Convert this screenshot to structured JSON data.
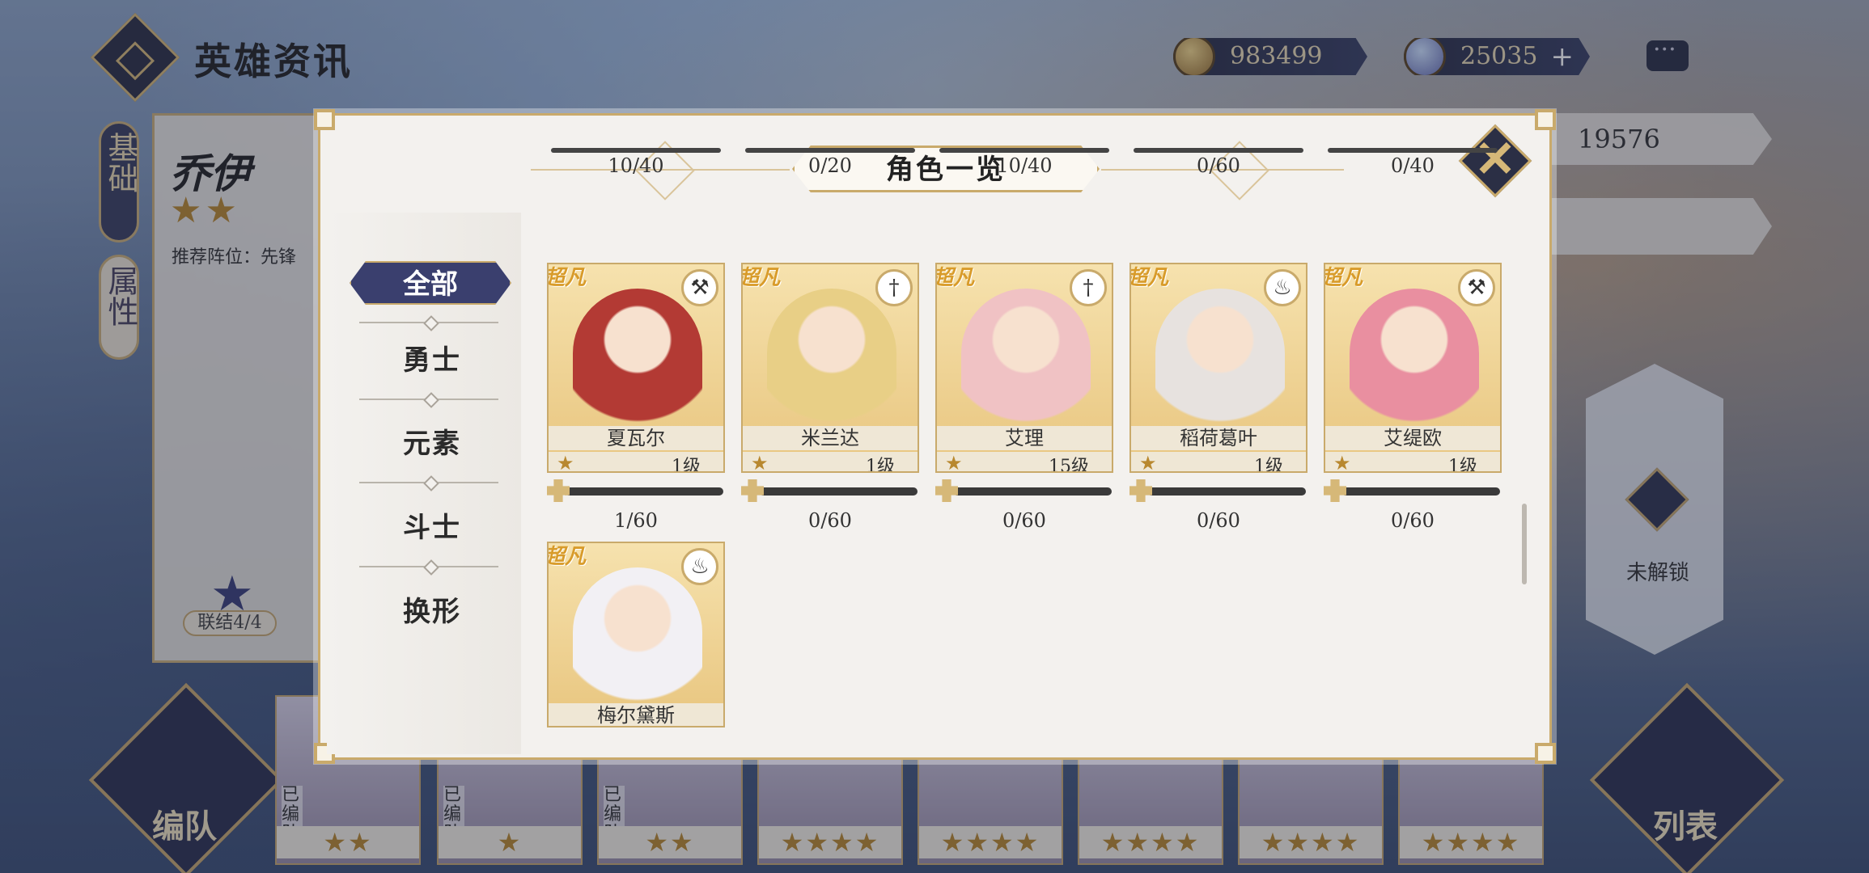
{
  "top": {
    "title": "英雄资讯",
    "gold": "983499",
    "gems": "25035",
    "gems_plus": "+"
  },
  "hero": {
    "name": "乔伊",
    "stars": "★★",
    "recommend": "推荐阵位：先锋",
    "bond": "联结4/4",
    "power": "19576"
  },
  "side_tabs": [
    "基础",
    "属性"
  ],
  "lock": {
    "label": "未解锁"
  },
  "bottom": {
    "team_label": "编队",
    "list_label": "列表",
    "in_team": "已编队"
  },
  "roster_stars": [
    "★★",
    "★",
    "★★",
    "★★★★",
    "★★★★",
    "★★★★",
    "★★★★",
    "★★★★"
  ],
  "modal": {
    "title": "角色一览",
    "close": "✕",
    "filters": [
      "全部",
      "勇士",
      "元素",
      "斗士",
      "换形"
    ],
    "top_progress": [
      "10/40",
      "0/20",
      "10/40",
      "0/60",
      "0/40"
    ],
    "heroes": [
      {
        "name": "夏瓦尔",
        "level": "1级",
        "rarity": "超凡",
        "shard": "1/60",
        "shard_fill": 0.0167,
        "element_icon": "axe-icon"
      },
      {
        "name": "米兰达",
        "level": "1级",
        "rarity": "超凡",
        "shard": "0/60",
        "shard_fill": 0,
        "element_icon": "sword-icon"
      },
      {
        "name": "艾理",
        "level": "15级",
        "rarity": "超凡",
        "shard": "0/60",
        "shard_fill": 0,
        "element_icon": "sword-icon"
      },
      {
        "name": "稻荷葛叶",
        "level": "1级",
        "rarity": "超凡",
        "shard": "0/60",
        "shard_fill": 0,
        "element_icon": "flame-icon"
      },
      {
        "name": "艾缇欧",
        "level": "1级",
        "rarity": "超凡",
        "shard": "0/60",
        "shard_fill": 0,
        "element_icon": "axe-icon"
      },
      {
        "name": "梅尔黛斯",
        "level": "",
        "rarity": "超凡",
        "shard": "",
        "shard_fill": 0,
        "element_icon": "flame-icon"
      }
    ]
  },
  "colors": {
    "accent_gold": "#c9aa6b",
    "navy": "#3a3f6e",
    "portrait_colors": [
      "#b33a34",
      "#e8cf86",
      "#f0c2c4",
      "#e7e2df",
      "#e98fa0",
      "#f2f0f4"
    ]
  }
}
